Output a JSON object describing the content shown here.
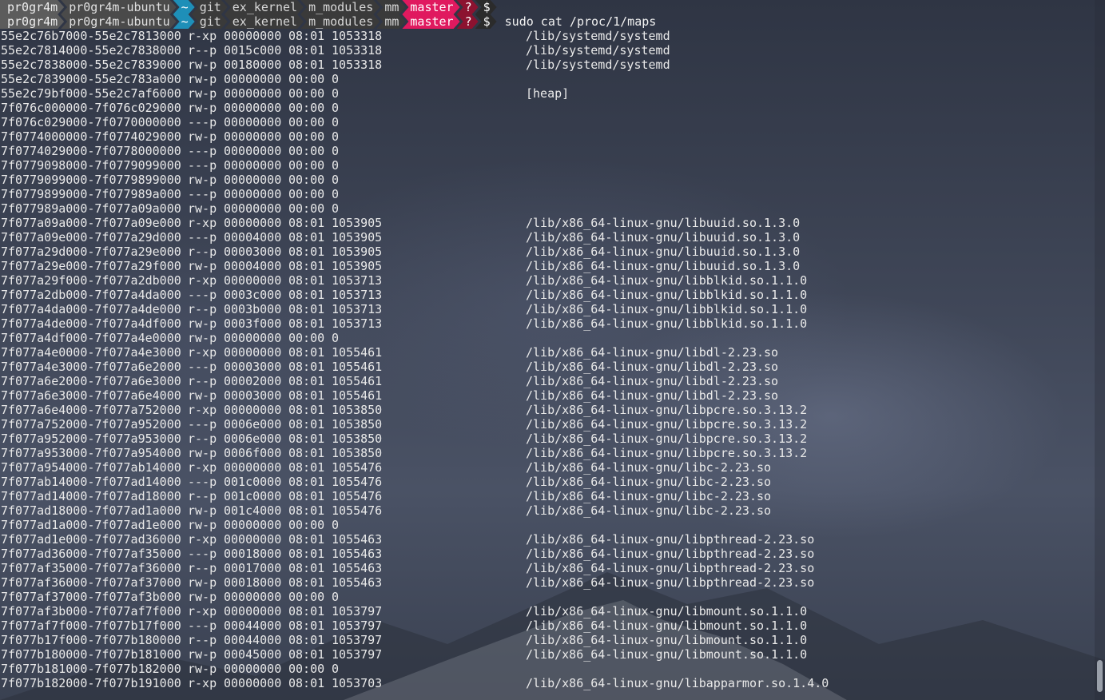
{
  "prompt": {
    "user": "pr0gr4m",
    "host": "pr0gr4m-ubuntu",
    "home": "~",
    "path": [
      "git",
      "ex_kernel",
      "m_modules",
      "mm"
    ],
    "branch": "master",
    "status": "?",
    "symbol": "$"
  },
  "command": "sudo cat /proc/1/maps",
  "colors": {
    "dir_bg": "#1e8fb8",
    "branch_bg": "#e0195f",
    "status_bg": "#8c1230",
    "text": "#e9e9e9"
  },
  "rows": [
    {
      "range": "55e2c76b7000-55e2c7813000",
      "perm": "r-xp",
      "offset": "00000000",
      "dev": "08:01",
      "inode": "1053318",
      "path": "/lib/systemd/systemd"
    },
    {
      "range": "55e2c7814000-55e2c7838000",
      "perm": "r--p",
      "offset": "0015c000",
      "dev": "08:01",
      "inode": "1053318",
      "path": "/lib/systemd/systemd"
    },
    {
      "range": "55e2c7838000-55e2c7839000",
      "perm": "rw-p",
      "offset": "00180000",
      "dev": "08:01",
      "inode": "1053318",
      "path": "/lib/systemd/systemd"
    },
    {
      "range": "55e2c7839000-55e2c783a000",
      "perm": "rw-p",
      "offset": "00000000",
      "dev": "00:00",
      "inode": "0",
      "path": ""
    },
    {
      "range": "55e2c79bf000-55e2c7af6000",
      "perm": "rw-p",
      "offset": "00000000",
      "dev": "00:00",
      "inode": "0",
      "path": "[heap]"
    },
    {
      "range": "7f076c000000-7f076c029000",
      "perm": "rw-p",
      "offset": "00000000",
      "dev": "00:00",
      "inode": "0",
      "path": ""
    },
    {
      "range": "7f076c029000-7f0770000000",
      "perm": "---p",
      "offset": "00000000",
      "dev": "00:00",
      "inode": "0",
      "path": ""
    },
    {
      "range": "7f0774000000-7f0774029000",
      "perm": "rw-p",
      "offset": "00000000",
      "dev": "00:00",
      "inode": "0",
      "path": ""
    },
    {
      "range": "7f0774029000-7f0778000000",
      "perm": "---p",
      "offset": "00000000",
      "dev": "00:00",
      "inode": "0",
      "path": ""
    },
    {
      "range": "7f0779098000-7f0779099000",
      "perm": "---p",
      "offset": "00000000",
      "dev": "00:00",
      "inode": "0",
      "path": ""
    },
    {
      "range": "7f0779099000-7f0779899000",
      "perm": "rw-p",
      "offset": "00000000",
      "dev": "00:00",
      "inode": "0",
      "path": ""
    },
    {
      "range": "7f0779899000-7f077989a000",
      "perm": "---p",
      "offset": "00000000",
      "dev": "00:00",
      "inode": "0",
      "path": ""
    },
    {
      "range": "7f077989a000-7f077a09a000",
      "perm": "rw-p",
      "offset": "00000000",
      "dev": "00:00",
      "inode": "0",
      "path": ""
    },
    {
      "range": "7f077a09a000-7f077a09e000",
      "perm": "r-xp",
      "offset": "00000000",
      "dev": "08:01",
      "inode": "1053905",
      "path": "/lib/x86_64-linux-gnu/libuuid.so.1.3.0"
    },
    {
      "range": "7f077a09e000-7f077a29d000",
      "perm": "---p",
      "offset": "00004000",
      "dev": "08:01",
      "inode": "1053905",
      "path": "/lib/x86_64-linux-gnu/libuuid.so.1.3.0"
    },
    {
      "range": "7f077a29d000-7f077a29e000",
      "perm": "r--p",
      "offset": "00003000",
      "dev": "08:01",
      "inode": "1053905",
      "path": "/lib/x86_64-linux-gnu/libuuid.so.1.3.0"
    },
    {
      "range": "7f077a29e000-7f077a29f000",
      "perm": "rw-p",
      "offset": "00004000",
      "dev": "08:01",
      "inode": "1053905",
      "path": "/lib/x86_64-linux-gnu/libuuid.so.1.3.0"
    },
    {
      "range": "7f077a29f000-7f077a2db000",
      "perm": "r-xp",
      "offset": "00000000",
      "dev": "08:01",
      "inode": "1053713",
      "path": "/lib/x86_64-linux-gnu/libblkid.so.1.1.0"
    },
    {
      "range": "7f077a2db000-7f077a4da000",
      "perm": "---p",
      "offset": "0003c000",
      "dev": "08:01",
      "inode": "1053713",
      "path": "/lib/x86_64-linux-gnu/libblkid.so.1.1.0"
    },
    {
      "range": "7f077a4da000-7f077a4de000",
      "perm": "r--p",
      "offset": "0003b000",
      "dev": "08:01",
      "inode": "1053713",
      "path": "/lib/x86_64-linux-gnu/libblkid.so.1.1.0"
    },
    {
      "range": "7f077a4de000-7f077a4df000",
      "perm": "rw-p",
      "offset": "0003f000",
      "dev": "08:01",
      "inode": "1053713",
      "path": "/lib/x86_64-linux-gnu/libblkid.so.1.1.0"
    },
    {
      "range": "7f077a4df000-7f077a4e0000",
      "perm": "rw-p",
      "offset": "00000000",
      "dev": "00:00",
      "inode": "0",
      "path": ""
    },
    {
      "range": "7f077a4e0000-7f077a4e3000",
      "perm": "r-xp",
      "offset": "00000000",
      "dev": "08:01",
      "inode": "1055461",
      "path": "/lib/x86_64-linux-gnu/libdl-2.23.so"
    },
    {
      "range": "7f077a4e3000-7f077a6e2000",
      "perm": "---p",
      "offset": "00003000",
      "dev": "08:01",
      "inode": "1055461",
      "path": "/lib/x86_64-linux-gnu/libdl-2.23.so"
    },
    {
      "range": "7f077a6e2000-7f077a6e3000",
      "perm": "r--p",
      "offset": "00002000",
      "dev": "08:01",
      "inode": "1055461",
      "path": "/lib/x86_64-linux-gnu/libdl-2.23.so"
    },
    {
      "range": "7f077a6e3000-7f077a6e4000",
      "perm": "rw-p",
      "offset": "00003000",
      "dev": "08:01",
      "inode": "1055461",
      "path": "/lib/x86_64-linux-gnu/libdl-2.23.so"
    },
    {
      "range": "7f077a6e4000-7f077a752000",
      "perm": "r-xp",
      "offset": "00000000",
      "dev": "08:01",
      "inode": "1053850",
      "path": "/lib/x86_64-linux-gnu/libpcre.so.3.13.2"
    },
    {
      "range": "7f077a752000-7f077a952000",
      "perm": "---p",
      "offset": "0006e000",
      "dev": "08:01",
      "inode": "1053850",
      "path": "/lib/x86_64-linux-gnu/libpcre.so.3.13.2"
    },
    {
      "range": "7f077a952000-7f077a953000",
      "perm": "r--p",
      "offset": "0006e000",
      "dev": "08:01",
      "inode": "1053850",
      "path": "/lib/x86_64-linux-gnu/libpcre.so.3.13.2"
    },
    {
      "range": "7f077a953000-7f077a954000",
      "perm": "rw-p",
      "offset": "0006f000",
      "dev": "08:01",
      "inode": "1053850",
      "path": "/lib/x86_64-linux-gnu/libpcre.so.3.13.2"
    },
    {
      "range": "7f077a954000-7f077ab14000",
      "perm": "r-xp",
      "offset": "00000000",
      "dev": "08:01",
      "inode": "1055476",
      "path": "/lib/x86_64-linux-gnu/libc-2.23.so"
    },
    {
      "range": "7f077ab14000-7f077ad14000",
      "perm": "---p",
      "offset": "001c0000",
      "dev": "08:01",
      "inode": "1055476",
      "path": "/lib/x86_64-linux-gnu/libc-2.23.so"
    },
    {
      "range": "7f077ad14000-7f077ad18000",
      "perm": "r--p",
      "offset": "001c0000",
      "dev": "08:01",
      "inode": "1055476",
      "path": "/lib/x86_64-linux-gnu/libc-2.23.so"
    },
    {
      "range": "7f077ad18000-7f077ad1a000",
      "perm": "rw-p",
      "offset": "001c4000",
      "dev": "08:01",
      "inode": "1055476",
      "path": "/lib/x86_64-linux-gnu/libc-2.23.so"
    },
    {
      "range": "7f077ad1a000-7f077ad1e000",
      "perm": "rw-p",
      "offset": "00000000",
      "dev": "00:00",
      "inode": "0",
      "path": ""
    },
    {
      "range": "7f077ad1e000-7f077ad36000",
      "perm": "r-xp",
      "offset": "00000000",
      "dev": "08:01",
      "inode": "1055463",
      "path": "/lib/x86_64-linux-gnu/libpthread-2.23.so"
    },
    {
      "range": "7f077ad36000-7f077af35000",
      "perm": "---p",
      "offset": "00018000",
      "dev": "08:01",
      "inode": "1055463",
      "path": "/lib/x86_64-linux-gnu/libpthread-2.23.so"
    },
    {
      "range": "7f077af35000-7f077af36000",
      "perm": "r--p",
      "offset": "00017000",
      "dev": "08:01",
      "inode": "1055463",
      "path": "/lib/x86_64-linux-gnu/libpthread-2.23.so"
    },
    {
      "range": "7f077af36000-7f077af37000",
      "perm": "rw-p",
      "offset": "00018000",
      "dev": "08:01",
      "inode": "1055463",
      "path": "/lib/x86_64-linux-gnu/libpthread-2.23.so"
    },
    {
      "range": "7f077af37000-7f077af3b000",
      "perm": "rw-p",
      "offset": "00000000",
      "dev": "00:00",
      "inode": "0",
      "path": ""
    },
    {
      "range": "7f077af3b000-7f077af7f000",
      "perm": "r-xp",
      "offset": "00000000",
      "dev": "08:01",
      "inode": "1053797",
      "path": "/lib/x86_64-linux-gnu/libmount.so.1.1.0"
    },
    {
      "range": "7f077af7f000-7f077b17f000",
      "perm": "---p",
      "offset": "00044000",
      "dev": "08:01",
      "inode": "1053797",
      "path": "/lib/x86_64-linux-gnu/libmount.so.1.1.0"
    },
    {
      "range": "7f077b17f000-7f077b180000",
      "perm": "r--p",
      "offset": "00044000",
      "dev": "08:01",
      "inode": "1053797",
      "path": "/lib/x86_64-linux-gnu/libmount.so.1.1.0"
    },
    {
      "range": "7f077b180000-7f077b181000",
      "perm": "rw-p",
      "offset": "00045000",
      "dev": "08:01",
      "inode": "1053797",
      "path": "/lib/x86_64-linux-gnu/libmount.so.1.1.0"
    },
    {
      "range": "7f077b181000-7f077b182000",
      "perm": "rw-p",
      "offset": "00000000",
      "dev": "00:00",
      "inode": "0",
      "path": ""
    },
    {
      "range": "7f077b182000-7f077b191000",
      "perm": "r-xp",
      "offset": "00000000",
      "dev": "08:01",
      "inode": "1053703",
      "path": "/lib/x86_64-linux-gnu/libapparmor.so.1.4.0"
    }
  ]
}
